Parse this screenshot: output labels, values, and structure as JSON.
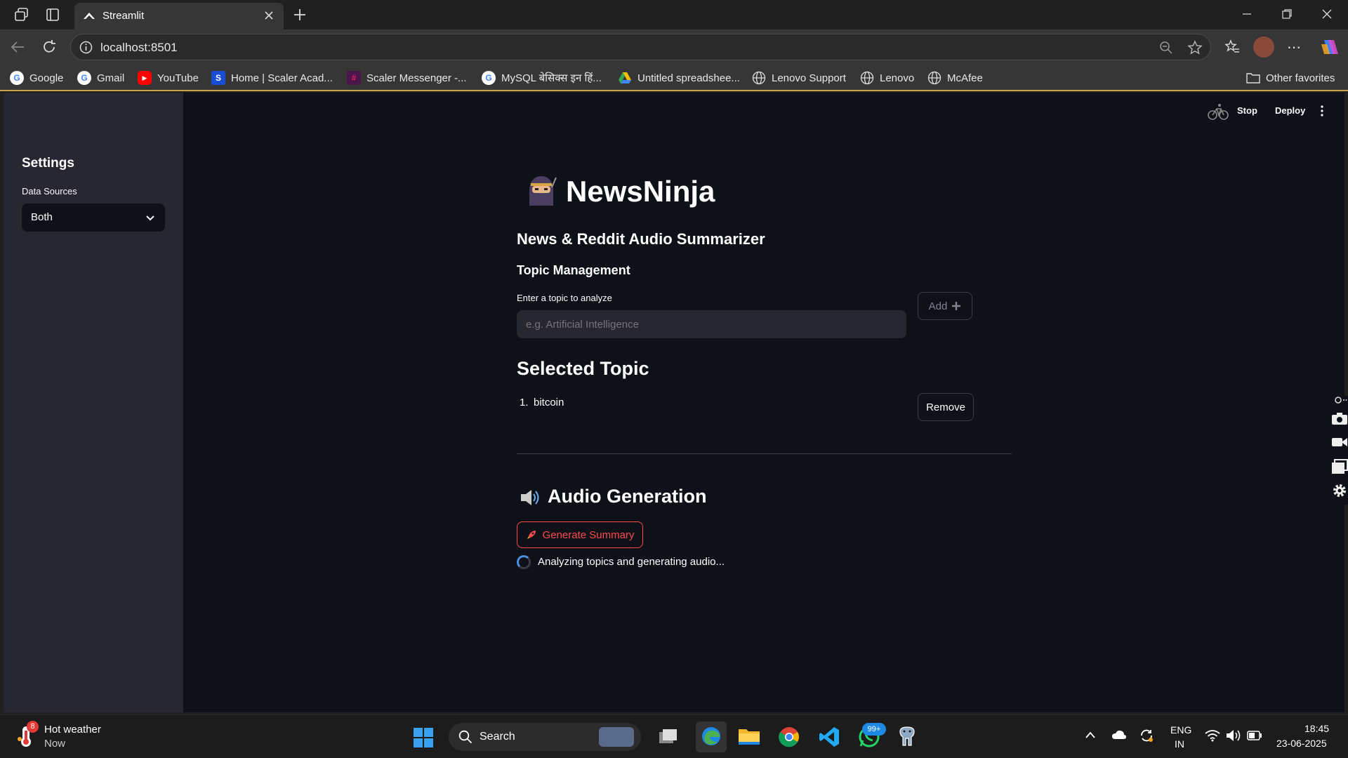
{
  "browser": {
    "tab_title": "Streamlit",
    "url": "localhost:8501",
    "bookmarks": [
      {
        "label": "Google",
        "icon": "google-icon"
      },
      {
        "label": "Gmail",
        "icon": "google-icon"
      },
      {
        "label": "YouTube",
        "icon": "youtube-icon"
      },
      {
        "label": "Home | Scaler Acad...",
        "icon": "scaler-icon"
      },
      {
        "label": "Scaler Messenger -...",
        "icon": "slack-icon"
      },
      {
        "label": "MySQL बेसिक्स इन हिं...",
        "icon": "google-icon"
      },
      {
        "label": "Untitled spreadshee...",
        "icon": "drive-icon"
      },
      {
        "label": "Lenovo Support",
        "icon": "globe-icon"
      },
      {
        "label": "Lenovo",
        "icon": "globe-icon"
      },
      {
        "label": "McAfee",
        "icon": "globe-icon"
      }
    ],
    "other_favorites": "Other favorites"
  },
  "sidebar": {
    "title": "Settings",
    "data_sources_label": "Data Sources",
    "data_sources_value": "Both"
  },
  "topbar": {
    "stop": "Stop",
    "deploy": "Deploy"
  },
  "main": {
    "title": "NewsNinja",
    "subtitle": "News & Reddit Audio Summarizer",
    "topic_heading": "Topic Management",
    "input_label": "Enter a topic to analyze",
    "input_placeholder": "e.g. Artificial Intelligence",
    "add_button": "Add",
    "selected_heading": "Selected Topic",
    "topics": [
      {
        "num": "1.",
        "text": "bitcoin"
      }
    ],
    "remove_button": "Remove",
    "audio_heading": "Audio Generation",
    "generate_button": "Generate Summary",
    "status_text": "Analyzing topics and generating audio..."
  },
  "taskbar": {
    "weather_title": "Hot weather",
    "weather_sub": "Now",
    "weather_badge": "8",
    "search": "Search",
    "whatsapp_badge": "99+",
    "lang_top": "ENG",
    "lang_bottom": "IN",
    "time": "18:45",
    "date": "23-06-2025"
  },
  "colors": {
    "app_bg": "#0e1117",
    "sidebar_bg": "#262730",
    "accent_red": "#ff4b4b"
  }
}
